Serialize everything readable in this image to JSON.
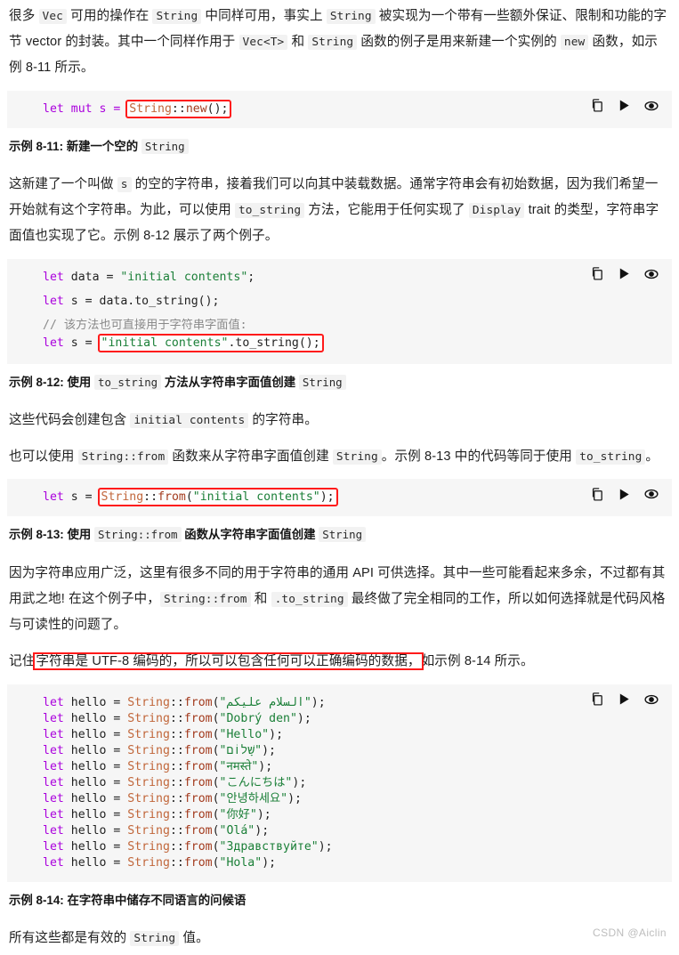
{
  "document": {
    "watermark": "CSDN @Aiclin",
    "intro_paragraph": {
      "s1": "很多 ",
      "c1": "Vec",
      "s2": " 可用的操作在 ",
      "c2": "String",
      "s3": " 中同样可用，事实上 ",
      "c3": "String",
      "s4": " 被实现为一个带有一些额外保证、限制和功能的字节 vector 的封装。其中一个同样作用于 ",
      "c4": "Vec<T>",
      "s5": " 和 ",
      "c5": "String",
      "s6": " 函数的例子是用来新建一个实例的 ",
      "c6": "new",
      "s7": " 函数，如示例 8-11 所示。"
    },
    "caption_8_11": {
      "label": "示例 8-11: 新建一个空的 ",
      "code": "String"
    },
    "para_after_8_11": {
      "s1": "这新建了一个叫做 ",
      "c1": "s",
      "s2": " 的空的字符串，接着我们可以向其中装载数据。通常字符串会有初始数据，因为我们希望一开始就有这个字符串。为此，可以使用 ",
      "c2": "to_string",
      "s3": " 方法，它能用于任何实现了 ",
      "c3": "Display",
      "s4": " trait 的类型，字符串字面值也实现了它。示例 8-12 展示了两个例子。"
    },
    "caption_8_12": {
      "s1": "示例 8-12: 使用 ",
      "c1": "to_string",
      "s2": " 方法从字符串字面值创建 ",
      "c2": "String"
    },
    "para_after_8_12": {
      "s1": "这些代码会创建包含 ",
      "c1": "initial contents",
      "s2": " 的字符串。"
    },
    "para_before_8_13": {
      "s1": "也可以使用 ",
      "c1": "String::from",
      "s2": " 函数来从字符串字面值创建 ",
      "c2": "String",
      "s3": "。示例 8-13 中的代码等同于使用 ",
      "c3": "to_string",
      "s4": "。"
    },
    "caption_8_13": {
      "s1": "示例 8-13: 使用 ",
      "c1": "String::from",
      "s2": " 函数从字符串字面值创建 ",
      "c2": "String"
    },
    "para_api": {
      "s1": "因为字符串应用广泛，这里有很多不同的用于字符串的通用 API 可供选择。其中一些可能看起来多余，不过都有其用武之地! 在这个例子中，",
      "c1": "String::from",
      "s2": " 和 ",
      "c2": ".to_string",
      "s3": " 最终做了完全相同的工作，所以如何选择就是代码风格与可读性的问题了。"
    },
    "para_utf8": {
      "s1": "记住",
      "highlight": "字符串是 UTF-8 编码的，所以可以包含任何可以正确编码的数据，",
      "s2": "如示例 8-14 所示。"
    },
    "caption_8_14": {
      "label": "示例 8-14: 在字符串中储存不同语言的问候语"
    },
    "para_final": {
      "s1": "所有这些都是有效的 ",
      "c1": "String",
      "s2": " 值。"
    }
  },
  "toolbar": {
    "copy_label": "copy-icon",
    "run_label": "run-icon",
    "preview_label": "preview-icon"
  },
  "code_blocks": {
    "block_8_11": {
      "line1_pre": "let mut s = ",
      "line1_boxed_type": "String",
      "line1_boxed_sep": "::",
      "line1_boxed_fn": "new",
      "line1_boxed_tail": "();"
    },
    "block_8_12": {
      "l1_kw": "let",
      "l1_id": " data = ",
      "l1_str": "\"initial contents\"",
      "l1_end": ";",
      "l2_kw": "let",
      "l2_id": " s = data.to_string();",
      "l3_comment": "// 该方法也可直接用于字符串字面值:",
      "l4_kw": "let",
      "l4_id": " s = ",
      "l4_boxed_str": "\"initial contents\"",
      "l4_boxed_tail": ".to_string();"
    },
    "block_8_13": {
      "l1_kw": "let",
      "l1_id": " s = ",
      "l1_boxed_type": "String",
      "l1_boxed_sep": "::",
      "l1_boxed_fn": "from",
      "l1_boxed_open": "(",
      "l1_boxed_str": "\"initial contents\"",
      "l1_boxed_close": ");"
    },
    "block_8_14": {
      "prefix_kw": "let",
      "prefix_id": " hello = ",
      "type_name": "String",
      "sep": "::",
      "fn_name": "from",
      "open": "(",
      "close": ");",
      "greetings": [
        "\"السلام عليكم\"",
        "\"Dobrý den\"",
        "\"Hello\"",
        "\"שָׁלוֹם\"",
        "\"नमस्ते\"",
        "\"こんにちは\"",
        "\"안녕하세요\"",
        "\"你好\"",
        "\"Olá\"",
        "\"Здравствуйте\"",
        "\"Hola\""
      ]
    }
  },
  "colors": {
    "code_background": "#f6f6f6",
    "inline_code_background": "#f2f2f2",
    "annotation_red": "#ff1a1a",
    "keyword": "#aa00dd",
    "string": "#1a7f37",
    "type": "#c1663a",
    "function": "#a33b1e",
    "comment": "#8a8a8a",
    "watermark": "#bdbdbd"
  }
}
